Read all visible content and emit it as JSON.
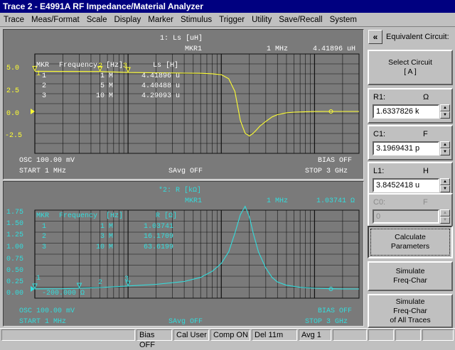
{
  "window": {
    "title": "Trace 2 - E4991A RF Impedance/Material Analyzer"
  },
  "menu": [
    "Trace",
    "Meas/Format",
    "Scale",
    "Display",
    "Marker",
    "Stimulus",
    "Trigger",
    "Utility",
    "Save/Recall",
    "System"
  ],
  "trace1": {
    "header": "1: Ls [uH]",
    "marker_label": "MKR1",
    "marker_freq": "1 MHz",
    "marker_value": "4.41896 uH",
    "color": "#ffff33",
    "y_ticks": [
      "5.0",
      "2.5",
      "0.0",
      "-2.5"
    ],
    "table": {
      "headers": [
        "MKR",
        "Frequency",
        "[Hz]",
        "Ls [H]"
      ],
      "rows": [
        [
          "1",
          "1 M",
          "4.41896 u"
        ],
        [
          "2",
          "5 M",
          "4.40488 u"
        ],
        [
          "3",
          "10 M",
          "4.29093 u"
        ]
      ]
    },
    "osc": "OSC 100.00 mV",
    "bias": "BIAS OFF",
    "start": "START  1 MHz",
    "savg": "SAvg OFF",
    "stop": "STOP  3 GHz",
    "marker_tags": [
      "1",
      "2",
      "3"
    ]
  },
  "trace2": {
    "header": "*2: R [kΩ]",
    "marker_label": "MKR1",
    "marker_freq": "1 MHz",
    "marker_value": "1.03741 Ω",
    "color": "#33dddd",
    "y_ticks": [
      "1.75",
      "1.50",
      "1.25",
      "1.00",
      "0.75",
      "0.50",
      "0.25",
      "0.00"
    ],
    "bottom_ref": "-200.000 Ω",
    "table": {
      "headers": [
        "MKR",
        "Frequency",
        "[Hz]",
        "R [Ω]"
      ],
      "rows": [
        [
          "1",
          "1 M",
          "1.03741"
        ],
        [
          "2",
          "3 M",
          "16.1709"
        ],
        [
          "3",
          "10 M",
          "63.6199"
        ]
      ]
    },
    "osc": "OSC 100.00 mV",
    "bias": "BIAS OFF",
    "start": "START  1 MHz",
    "savg": "SAvg OFF",
    "stop": "STOP  3 GHz",
    "marker_tags": [
      "1",
      "2",
      "3"
    ]
  },
  "panel": {
    "title": "Equivalent Circuit:",
    "back_glyph": "«",
    "select_circuit": "Select Circuit",
    "select_circuit_value": "[ A ]",
    "params": [
      {
        "label": "R1:",
        "unit": "Ω",
        "value": "1.6337826 k",
        "enabled": true
      },
      {
        "label": "C1:",
        "unit": "F",
        "value": "3.1969431 p",
        "enabled": true
      },
      {
        "label": "L1:",
        "unit": "H",
        "value": "3.8452418 u",
        "enabled": true
      },
      {
        "label": "C0:",
        "unit": "F",
        "value": "0",
        "enabled": false
      }
    ],
    "calculate_line1": "Calculate",
    "calculate_line2": "Parameters",
    "simulate_line1": "Simulate",
    "simulate_line2": "Freq-Char",
    "simulate_all_line1": "Simulate",
    "simulate_all_line2": "Freq-Char",
    "simulate_all_line3": "of All Traces"
  },
  "status": [
    "Bias OFF",
    "Cal User",
    "Comp ON",
    "Del 11m",
    "Avg  1"
  ]
}
